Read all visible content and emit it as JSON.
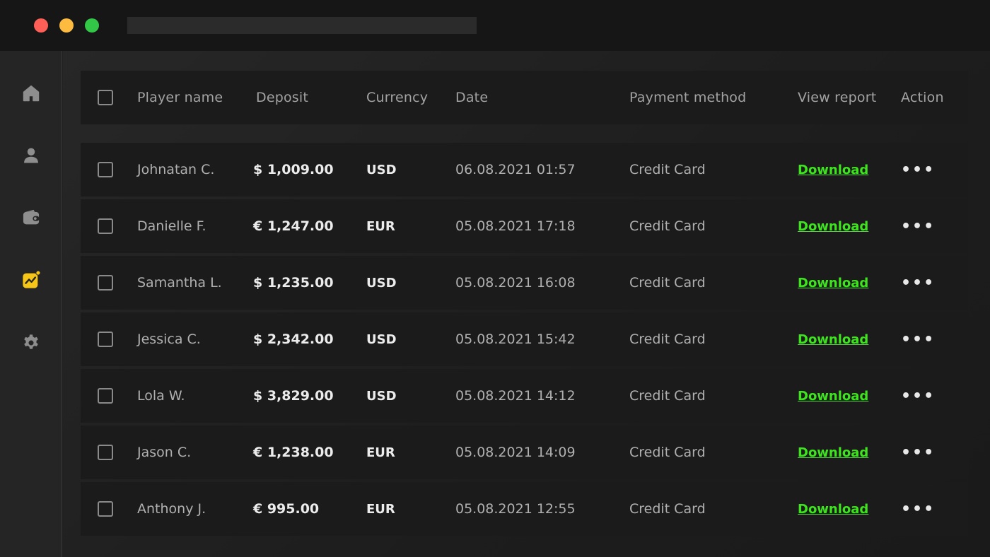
{
  "window": {
    "controls": [
      "close",
      "minimize",
      "maximize"
    ],
    "colors": {
      "close": "#ff5f57",
      "minimize": "#fdbc40",
      "maximize": "#33c748"
    }
  },
  "sidebar": {
    "items": [
      {
        "icon": "home-icon",
        "active": false
      },
      {
        "icon": "user-icon",
        "active": false
      },
      {
        "icon": "wallet-icon",
        "active": false
      },
      {
        "icon": "chart-icon",
        "active": true
      },
      {
        "icon": "gear-icon",
        "active": false
      }
    ],
    "accent": "#f5c518"
  },
  "table": {
    "headers": {
      "player_name": "Player name",
      "deposit": "Deposit",
      "currency": "Currency",
      "date": "Date",
      "payment_method": "Payment method",
      "view_report": "View report",
      "action": "Action"
    },
    "rows": [
      {
        "name": "Johnatan C.",
        "deposit": "$ 1,009.00",
        "currency": "USD",
        "date": "06.08.2021 01:57",
        "method": "Credit Card",
        "report": "Download",
        "action": "•••"
      },
      {
        "name": "Danielle F.",
        "deposit": "€ 1,247.00",
        "currency": "EUR",
        "date": "05.08.2021 17:18",
        "method": "Credit Card",
        "report": "Download",
        "action": "•••"
      },
      {
        "name": "Samantha L.",
        "deposit": "$ 1,235.00",
        "currency": "USD",
        "date": "05.08.2021 16:08",
        "method": "Credit Card",
        "report": "Download",
        "action": "•••"
      },
      {
        "name": "Jessica C.",
        "deposit": "$ 2,342.00",
        "currency": "USD",
        "date": "05.08.2021 15:42",
        "method": "Credit Card",
        "report": "Download",
        "action": "•••"
      },
      {
        "name": "Lola W.",
        "deposit": "$ 3,829.00",
        "currency": "USD",
        "date": "05.08.2021 14:12",
        "method": "Credit Card",
        "report": "Download",
        "action": "•••"
      },
      {
        "name": "Jason C.",
        "deposit": "€ 1,238.00",
        "currency": "EUR",
        "date": "05.08.2021 14:09",
        "method": "Credit Card",
        "report": "Download",
        "action": "•••"
      },
      {
        "name": "Anthony J.",
        "deposit": "€ 995.00",
        "currency": "EUR",
        "date": "05.08.2021 12:55",
        "method": "Credit Card",
        "report": "Download",
        "action": "•••"
      }
    ],
    "link_color": "#3ee51f"
  }
}
